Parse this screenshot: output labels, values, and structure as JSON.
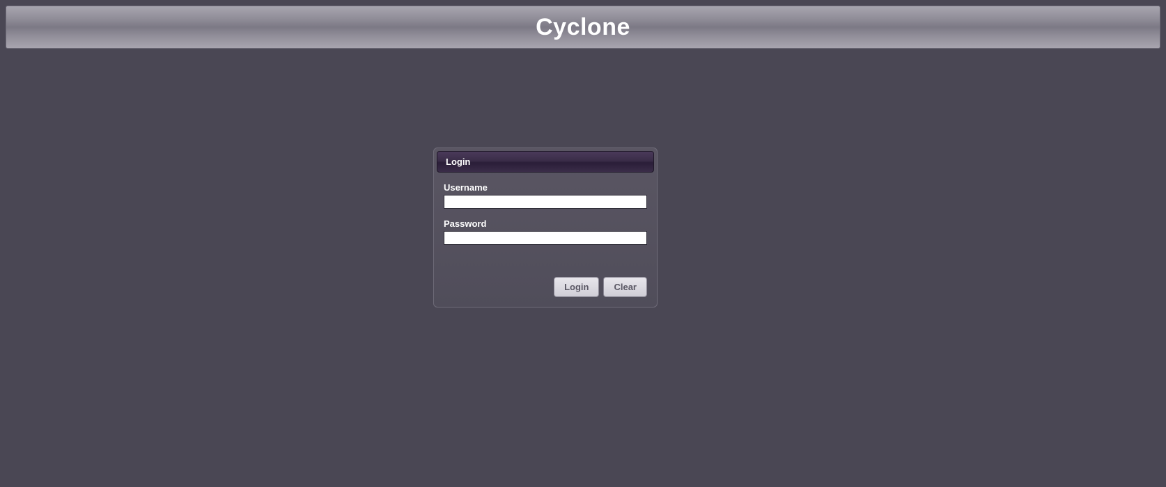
{
  "header": {
    "title": "Cyclone"
  },
  "login": {
    "panel_title": "Login",
    "username_label": "Username",
    "username_value": "",
    "password_label": "Password",
    "password_value": "",
    "login_button": "Login",
    "clear_button": "Clear"
  }
}
